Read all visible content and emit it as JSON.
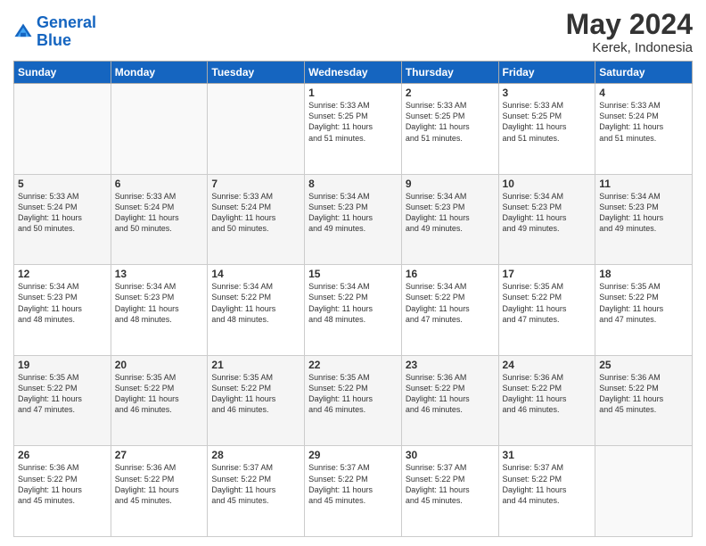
{
  "header": {
    "logo_line1": "General",
    "logo_line2": "Blue",
    "main_title": "May 2024",
    "subtitle": "Kerek, Indonesia"
  },
  "calendar": {
    "headers": [
      "Sunday",
      "Monday",
      "Tuesday",
      "Wednesday",
      "Thursday",
      "Friday",
      "Saturday"
    ],
    "weeks": [
      [
        {
          "day": "",
          "info": ""
        },
        {
          "day": "",
          "info": ""
        },
        {
          "day": "",
          "info": ""
        },
        {
          "day": "1",
          "info": "Sunrise: 5:33 AM\nSunset: 5:25 PM\nDaylight: 11 hours\nand 51 minutes."
        },
        {
          "day": "2",
          "info": "Sunrise: 5:33 AM\nSunset: 5:25 PM\nDaylight: 11 hours\nand 51 minutes."
        },
        {
          "day": "3",
          "info": "Sunrise: 5:33 AM\nSunset: 5:25 PM\nDaylight: 11 hours\nand 51 minutes."
        },
        {
          "day": "4",
          "info": "Sunrise: 5:33 AM\nSunset: 5:24 PM\nDaylight: 11 hours\nand 51 minutes."
        }
      ],
      [
        {
          "day": "5",
          "info": "Sunrise: 5:33 AM\nSunset: 5:24 PM\nDaylight: 11 hours\nand 50 minutes."
        },
        {
          "day": "6",
          "info": "Sunrise: 5:33 AM\nSunset: 5:24 PM\nDaylight: 11 hours\nand 50 minutes."
        },
        {
          "day": "7",
          "info": "Sunrise: 5:33 AM\nSunset: 5:24 PM\nDaylight: 11 hours\nand 50 minutes."
        },
        {
          "day": "8",
          "info": "Sunrise: 5:34 AM\nSunset: 5:23 PM\nDaylight: 11 hours\nand 49 minutes."
        },
        {
          "day": "9",
          "info": "Sunrise: 5:34 AM\nSunset: 5:23 PM\nDaylight: 11 hours\nand 49 minutes."
        },
        {
          "day": "10",
          "info": "Sunrise: 5:34 AM\nSunset: 5:23 PM\nDaylight: 11 hours\nand 49 minutes."
        },
        {
          "day": "11",
          "info": "Sunrise: 5:34 AM\nSunset: 5:23 PM\nDaylight: 11 hours\nand 49 minutes."
        }
      ],
      [
        {
          "day": "12",
          "info": "Sunrise: 5:34 AM\nSunset: 5:23 PM\nDaylight: 11 hours\nand 48 minutes."
        },
        {
          "day": "13",
          "info": "Sunrise: 5:34 AM\nSunset: 5:23 PM\nDaylight: 11 hours\nand 48 minutes."
        },
        {
          "day": "14",
          "info": "Sunrise: 5:34 AM\nSunset: 5:22 PM\nDaylight: 11 hours\nand 48 minutes."
        },
        {
          "day": "15",
          "info": "Sunrise: 5:34 AM\nSunset: 5:22 PM\nDaylight: 11 hours\nand 48 minutes."
        },
        {
          "day": "16",
          "info": "Sunrise: 5:34 AM\nSunset: 5:22 PM\nDaylight: 11 hours\nand 47 minutes."
        },
        {
          "day": "17",
          "info": "Sunrise: 5:35 AM\nSunset: 5:22 PM\nDaylight: 11 hours\nand 47 minutes."
        },
        {
          "day": "18",
          "info": "Sunrise: 5:35 AM\nSunset: 5:22 PM\nDaylight: 11 hours\nand 47 minutes."
        }
      ],
      [
        {
          "day": "19",
          "info": "Sunrise: 5:35 AM\nSunset: 5:22 PM\nDaylight: 11 hours\nand 47 minutes."
        },
        {
          "day": "20",
          "info": "Sunrise: 5:35 AM\nSunset: 5:22 PM\nDaylight: 11 hours\nand 46 minutes."
        },
        {
          "day": "21",
          "info": "Sunrise: 5:35 AM\nSunset: 5:22 PM\nDaylight: 11 hours\nand 46 minutes."
        },
        {
          "day": "22",
          "info": "Sunrise: 5:35 AM\nSunset: 5:22 PM\nDaylight: 11 hours\nand 46 minutes."
        },
        {
          "day": "23",
          "info": "Sunrise: 5:36 AM\nSunset: 5:22 PM\nDaylight: 11 hours\nand 46 minutes."
        },
        {
          "day": "24",
          "info": "Sunrise: 5:36 AM\nSunset: 5:22 PM\nDaylight: 11 hours\nand 46 minutes."
        },
        {
          "day": "25",
          "info": "Sunrise: 5:36 AM\nSunset: 5:22 PM\nDaylight: 11 hours\nand 45 minutes."
        }
      ],
      [
        {
          "day": "26",
          "info": "Sunrise: 5:36 AM\nSunset: 5:22 PM\nDaylight: 11 hours\nand 45 minutes."
        },
        {
          "day": "27",
          "info": "Sunrise: 5:36 AM\nSunset: 5:22 PM\nDaylight: 11 hours\nand 45 minutes."
        },
        {
          "day": "28",
          "info": "Sunrise: 5:37 AM\nSunset: 5:22 PM\nDaylight: 11 hours\nand 45 minutes."
        },
        {
          "day": "29",
          "info": "Sunrise: 5:37 AM\nSunset: 5:22 PM\nDaylight: 11 hours\nand 45 minutes."
        },
        {
          "day": "30",
          "info": "Sunrise: 5:37 AM\nSunset: 5:22 PM\nDaylight: 11 hours\nand 45 minutes."
        },
        {
          "day": "31",
          "info": "Sunrise: 5:37 AM\nSunset: 5:22 PM\nDaylight: 11 hours\nand 44 minutes."
        },
        {
          "day": "",
          "info": ""
        }
      ]
    ]
  }
}
